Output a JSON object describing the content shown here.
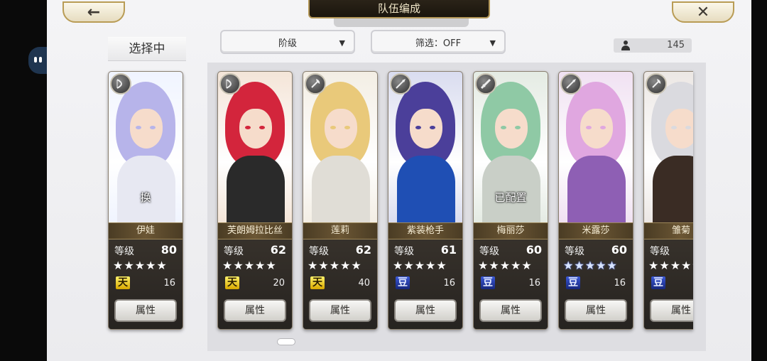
{
  "header": {
    "title": "队伍编成",
    "back_icon": "←",
    "close_icon": "✕"
  },
  "selecting_label": "选择中",
  "dropdowns": {
    "rank": {
      "label": "阶级",
      "arrow": "▼"
    },
    "filter": {
      "label": "筛选：OFF",
      "arrow": "▼"
    }
  },
  "unit_count": "145",
  "selected_card": {
    "name": "伊娃",
    "level_label": "等级",
    "level": "80",
    "star_color": "white",
    "rank_glyph": "天",
    "rank_color": "gold",
    "sub_value": "16",
    "overlay": "换",
    "attr_label": "属性",
    "colors": {
      "hair": "#b7b4ea",
      "bg": "#f0f4ff",
      "body": "#e7e8f2"
    }
  },
  "cards": [
    {
      "name": "芙朗姆拉比丝",
      "level_label": "等级",
      "level": "62",
      "star_color": "white",
      "rank_glyph": "天",
      "rank_color": "gold",
      "sub_value": "20",
      "overlay": "",
      "attr_label": "属性",
      "colors": {
        "hair": "#d3253c",
        "bg": "#f4e5d8",
        "body": "#2a2a2a"
      }
    },
    {
      "name": "莲莉",
      "level_label": "等级",
      "level": "62",
      "star_color": "white",
      "rank_glyph": "天",
      "rank_color": "gold",
      "sub_value": "40",
      "overlay": "",
      "attr_label": "属性",
      "colors": {
        "hair": "#e9c97a",
        "bg": "#f3eee4",
        "body": "#e0ddd6"
      }
    },
    {
      "name": "紫装枪手",
      "level_label": "等级",
      "level": "61",
      "star_color": "white",
      "rank_glyph": "豆",
      "rank_color": "blue",
      "sub_value": "16",
      "overlay": "",
      "attr_label": "属性",
      "colors": {
        "hair": "#4b3f9a",
        "bg": "#d9dcef",
        "body": "#1f4fb4"
      }
    },
    {
      "name": "梅丽莎",
      "level_label": "等级",
      "level": "60",
      "star_color": "white",
      "rank_glyph": "豆",
      "rank_color": "blue",
      "sub_value": "16",
      "overlay": "已配置",
      "attr_label": "属性",
      "colors": {
        "hair": "#8fc9a5",
        "bg": "#e4ebe3",
        "body": "#c9cfc7"
      }
    },
    {
      "name": "米露莎",
      "level_label": "等级",
      "level": "60",
      "star_color": "blue",
      "rank_glyph": "豆",
      "rank_color": "blue",
      "sub_value": "16",
      "overlay": "",
      "attr_label": "属性",
      "colors": {
        "hair": "#e0a7e0",
        "bg": "#f0e1f2",
        "body": "#8e5fb4"
      }
    },
    {
      "name": "雏菊",
      "level_label": "等级",
      "level": "",
      "star_color": "white",
      "rank_glyph": "豆",
      "rank_color": "blue",
      "sub_value": "",
      "overlay": "",
      "attr_label": "属性",
      "colors": {
        "hair": "#dadadf",
        "bg": "#ece7e4",
        "body": "#3a2c24"
      }
    }
  ],
  "class_icons": [
    "bow-class-icon",
    "bow-class-icon",
    "axe-class-icon",
    "spear-class-icon",
    "sword-class-icon",
    "spear-class-icon",
    "axe-class-icon"
  ],
  "star_glyph": "★"
}
